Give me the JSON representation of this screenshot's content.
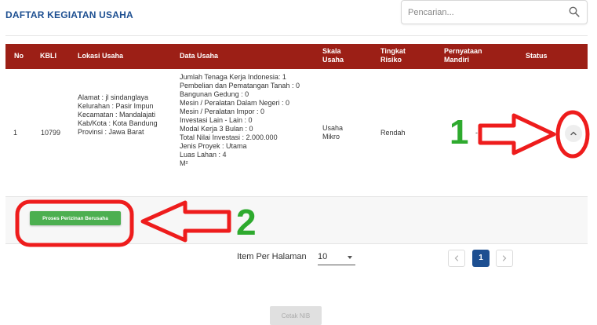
{
  "page": {
    "title": "DAFTAR KEGIATAN USAHA"
  },
  "search": {
    "placeholder": "Pencarian...",
    "icon": "search-icon"
  },
  "table": {
    "header_color": "#9c1f16",
    "headers": {
      "no": "No",
      "kbli": "KBLI",
      "lokasi": "Lokasi Usaha",
      "data": "Data Usaha",
      "skala": "Skala Usaha",
      "risiko": "Tingkat Risiko",
      "mandiri": "Pernyataan Mandiri",
      "status": "Status"
    },
    "rows": [
      {
        "no": "1",
        "kbli": "10799",
        "lokasi": [
          "Alamat : jl sindanglaya",
          "Kelurahan : Pasir Impun",
          "Kecamatan : Mandalajati",
          "Kab/Kota : Kota Bandung",
          "Provinsi : Jawa Barat"
        ],
        "data": [
          "Jumlah Tenaga Kerja Indonesia: 1",
          "Pembelian dan Pematangan Tanah : 0",
          "Bangunan Gedung : 0",
          "Mesin / Peralatan Dalam Negeri : 0",
          "Mesin / Peralatan Impor : 0",
          "Investasi Lain - Lain : 0",
          "Modal Kerja 3 Bulan : 0",
          "Total Nilai Investasi : 2.000.000",
          "Jenis Proyek : Utama",
          "Luas Lahan : 4",
          "M²"
        ],
        "skala": "Usaha Mikro",
        "risiko": "Rendah",
        "mandiri": "-",
        "expand_icon": "chevron-up-icon"
      }
    ]
  },
  "detail": {
    "proses_button": "Proses Perizinan Berusaha",
    "button_color": "#4caf50"
  },
  "pagination": {
    "label": "Item Per Halaman",
    "per_page": "10",
    "current_page": "1",
    "prev_icon": "chevron-left-icon",
    "next_icon": "chevron-right-icon",
    "active_color": "#1d4f91"
  },
  "footer": {
    "cetak_button": "Cetak NIB"
  },
  "annotations": {
    "label_1": "1",
    "label_2": "2",
    "arrow_color": "#ee1c1c",
    "label_color": "#2eaa2e"
  }
}
